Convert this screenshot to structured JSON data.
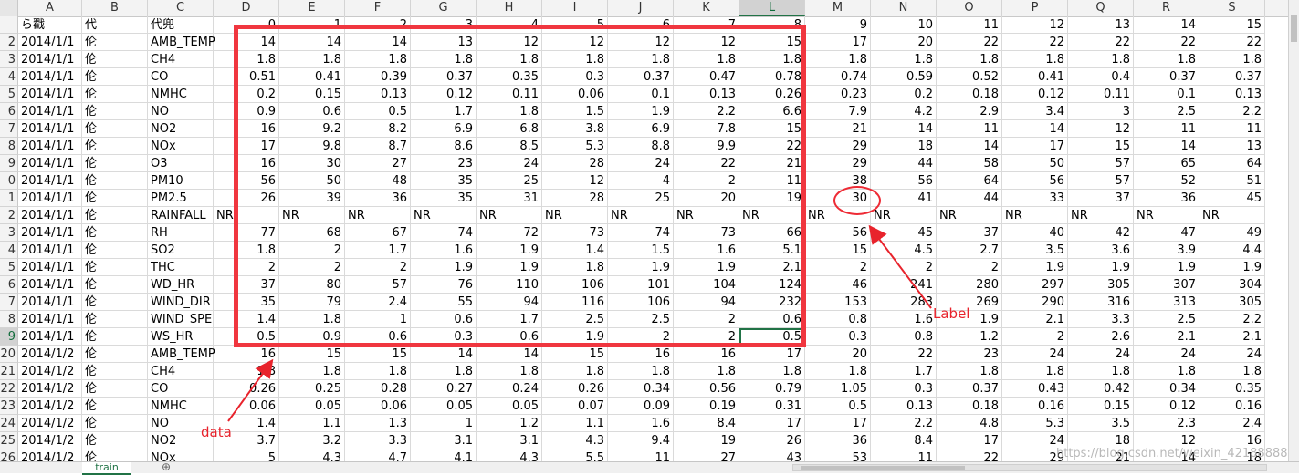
{
  "columns": [
    {
      "letter": "A",
      "w": 70
    },
    {
      "letter": "B",
      "w": 72
    },
    {
      "letter": "C",
      "w": 72
    },
    {
      "letter": "D",
      "w": 72
    },
    {
      "letter": "E",
      "w": 72
    },
    {
      "letter": "F",
      "w": 72
    },
    {
      "letter": "G",
      "w": 72
    },
    {
      "letter": "H",
      "w": 72
    },
    {
      "letter": "I",
      "w": 72
    },
    {
      "letter": "J",
      "w": 72
    },
    {
      "letter": "K",
      "w": 72
    },
    {
      "letter": "L",
      "w": 72
    },
    {
      "letter": "M",
      "w": 72
    },
    {
      "letter": "N",
      "w": 72
    },
    {
      "letter": "O",
      "w": 72
    },
    {
      "letter": "P",
      "w": 72
    },
    {
      "letter": "Q",
      "w": 72
    },
    {
      "letter": "R",
      "w": 72
    },
    {
      "letter": "S",
      "w": 72
    }
  ],
  "active_column": "L",
  "active_row": "19",
  "row_numbers": [
    "",
    "2",
    "3",
    "4",
    "5",
    "6",
    "7",
    "8",
    "9",
    "0",
    "1",
    "2",
    "3",
    "4",
    "5",
    "6",
    "7",
    "8",
    "9",
    "20",
    "21",
    "22",
    "23",
    "24",
    "25",
    "26"
  ],
  "rows": [
    [
      "ら戳",
      "代",
      "代兜",
      "0",
      "1",
      "2",
      "3",
      "4",
      "5",
      "6",
      "7",
      "8",
      "9",
      "10",
      "11",
      "12",
      "13",
      "14",
      "15"
    ],
    [
      "2014/1/1",
      "伦",
      "AMB_TEMP",
      "14",
      "14",
      "14",
      "13",
      "12",
      "12",
      "12",
      "12",
      "15",
      "17",
      "20",
      "22",
      "22",
      "22",
      "22",
      "22"
    ],
    [
      "2014/1/1",
      "伦",
      "CH4",
      "1.8",
      "1.8",
      "1.8",
      "1.8",
      "1.8",
      "1.8",
      "1.8",
      "1.8",
      "1.8",
      "1.8",
      "1.8",
      "1.8",
      "1.8",
      "1.8",
      "1.8",
      "1.8"
    ],
    [
      "2014/1/1",
      "伦",
      "CO",
      "0.51",
      "0.41",
      "0.39",
      "0.37",
      "0.35",
      "0.3",
      "0.37",
      "0.47",
      "0.78",
      "0.74",
      "0.59",
      "0.52",
      "0.41",
      "0.4",
      "0.37",
      "0.37"
    ],
    [
      "2014/1/1",
      "伦",
      "NMHC",
      "0.2",
      "0.15",
      "0.13",
      "0.12",
      "0.11",
      "0.06",
      "0.1",
      "0.13",
      "0.26",
      "0.23",
      "0.2",
      "0.18",
      "0.12",
      "0.11",
      "0.1",
      "0.13"
    ],
    [
      "2014/1/1",
      "伦",
      "NO",
      "0.9",
      "0.6",
      "0.5",
      "1.7",
      "1.8",
      "1.5",
      "1.9",
      "2.2",
      "6.6",
      "7.9",
      "4.2",
      "2.9",
      "3.4",
      "3",
      "2.5",
      "2.2"
    ],
    [
      "2014/1/1",
      "伦",
      "NO2",
      "16",
      "9.2",
      "8.2",
      "6.9",
      "6.8",
      "3.8",
      "6.9",
      "7.8",
      "15",
      "21",
      "14",
      "11",
      "14",
      "12",
      "11",
      "11"
    ],
    [
      "2014/1/1",
      "伦",
      "NOx",
      "17",
      "9.8",
      "8.7",
      "8.6",
      "8.5",
      "5.3",
      "8.8",
      "9.9",
      "22",
      "29",
      "18",
      "14",
      "17",
      "15",
      "14",
      "13"
    ],
    [
      "2014/1/1",
      "伦",
      "O3",
      "16",
      "30",
      "27",
      "23",
      "24",
      "28",
      "24",
      "22",
      "21",
      "29",
      "44",
      "58",
      "50",
      "57",
      "65",
      "64"
    ],
    [
      "2014/1/1",
      "伦",
      "PM10",
      "56",
      "50",
      "48",
      "35",
      "25",
      "12",
      "4",
      "2",
      "11",
      "38",
      "56",
      "64",
      "56",
      "57",
      "52",
      "51"
    ],
    [
      "2014/1/1",
      "伦",
      "PM2.5",
      "26",
      "39",
      "36",
      "35",
      "31",
      "28",
      "25",
      "20",
      "19",
      "30",
      "41",
      "44",
      "33",
      "37",
      "36",
      "45"
    ],
    [
      "2014/1/1",
      "伦",
      "RAINFALL",
      "NR",
      "NR",
      "NR",
      "NR",
      "NR",
      "NR",
      "NR",
      "NR",
      "NR",
      "NR",
      "NR",
      "NR",
      "NR",
      "NR",
      "NR",
      "NR",
      "NR"
    ],
    [
      "2014/1/1",
      "伦",
      "RH",
      "77",
      "68",
      "67",
      "74",
      "72",
      "73",
      "74",
      "73",
      "66",
      "56",
      "45",
      "37",
      "40",
      "42",
      "47",
      "49"
    ],
    [
      "2014/1/1",
      "伦",
      "SO2",
      "1.8",
      "2",
      "1.7",
      "1.6",
      "1.9",
      "1.4",
      "1.5",
      "1.6",
      "5.1",
      "15",
      "4.5",
      "2.7",
      "3.5",
      "3.6",
      "3.9",
      "4.4"
    ],
    [
      "2014/1/1",
      "伦",
      "THC",
      "2",
      "2",
      "2",
      "1.9",
      "1.9",
      "1.8",
      "1.9",
      "1.9",
      "2.1",
      "2",
      "2",
      "2",
      "1.9",
      "1.9",
      "1.9",
      "1.9"
    ],
    [
      "2014/1/1",
      "伦",
      "WD_HR",
      "37",
      "80",
      "57",
      "76",
      "110",
      "106",
      "101",
      "104",
      "124",
      "46",
      "241",
      "280",
      "297",
      "305",
      "307",
      "304"
    ],
    [
      "2014/1/1",
      "伦",
      "WIND_DIR",
      "35",
      "79",
      "2.4",
      "55",
      "94",
      "116",
      "106",
      "94",
      "232",
      "153",
      "283",
      "269",
      "290",
      "316",
      "313",
      "305"
    ],
    [
      "2014/1/1",
      "伦",
      "WIND_SPE",
      "1.4",
      "1.8",
      "1",
      "0.6",
      "1.7",
      "2.5",
      "2.5",
      "2",
      "0.6",
      "0.8",
      "1.6",
      "1.9",
      "2.1",
      "3.3",
      "2.5",
      "2.2"
    ],
    [
      "2014/1/1",
      "伦",
      "WS_HR",
      "0.5",
      "0.9",
      "0.6",
      "0.3",
      "0.6",
      "1.9",
      "2",
      "2",
      "0.5",
      "0.3",
      "0.8",
      "1.2",
      "2",
      "2.6",
      "2.1",
      "2.1"
    ],
    [
      "2014/1/2",
      "伦",
      "AMB_TEMP",
      "16",
      "15",
      "15",
      "14",
      "14",
      "15",
      "16",
      "16",
      "17",
      "20",
      "22",
      "23",
      "24",
      "24",
      "24",
      "24"
    ],
    [
      "2014/1/2",
      "伦",
      "CH4",
      "1.8",
      "1.8",
      "1.8",
      "1.8",
      "1.8",
      "1.8",
      "1.8",
      "1.8",
      "1.8",
      "1.8",
      "1.7",
      "1.8",
      "1.8",
      "1.8",
      "1.8",
      "1.8"
    ],
    [
      "2014/1/2",
      "伦",
      "CO",
      "0.26",
      "0.25",
      "0.28",
      "0.27",
      "0.24",
      "0.26",
      "0.34",
      "0.56",
      "0.79",
      "1.05",
      "0.3",
      "0.37",
      "0.43",
      "0.42",
      "0.34",
      "0.35"
    ],
    [
      "2014/1/2",
      "伦",
      "NMHC",
      "0.06",
      "0.05",
      "0.06",
      "0.05",
      "0.05",
      "0.07",
      "0.09",
      "0.19",
      "0.31",
      "0.5",
      "0.13",
      "0.18",
      "0.16",
      "0.15",
      "0.12",
      "0.16"
    ],
    [
      "2014/1/2",
      "伦",
      "NO",
      "1.4",
      "1.1",
      "1.3",
      "1",
      "1.2",
      "1.1",
      "1.6",
      "8.4",
      "17",
      "17",
      "2.2",
      "4.8",
      "5.3",
      "3.5",
      "2.3",
      "2.4"
    ],
    [
      "2014/1/2",
      "伦",
      "NO2",
      "3.7",
      "3.2",
      "3.3",
      "3.1",
      "3.1",
      "4.3",
      "9.4",
      "19",
      "26",
      "36",
      "8.4",
      "17",
      "24",
      "18",
      "12",
      "16"
    ],
    [
      "2014/1/2",
      "伦",
      "NOx",
      "5",
      "4.3",
      "4.7",
      "4.1",
      "4.3",
      "5.5",
      "11",
      "27",
      "43",
      "53",
      "11",
      "22",
      "29",
      "21",
      "14",
      "18"
    ]
  ],
  "annotations": {
    "data_label": "data",
    "label_label": "Label"
  },
  "sheet_tab": "train",
  "add_sheet_symbol": "⊕",
  "watermark": "https://blog.csdn.net/weixin_42188888",
  "colors": {
    "annotation_red": "#f0363f",
    "excel_green": "#217346"
  }
}
